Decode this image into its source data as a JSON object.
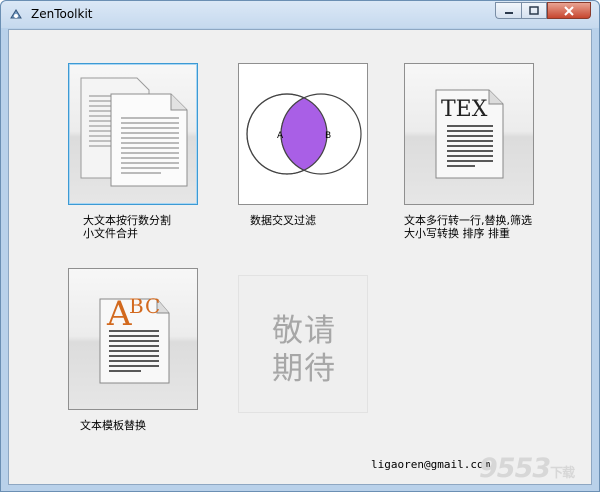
{
  "window": {
    "title": "ZenToolkit",
    "controls": {
      "minimize_icon": "minimize-icon",
      "maximize_icon": "maximize-icon",
      "close_icon": "close-icon"
    }
  },
  "tools": [
    {
      "caption": "大文本按行数分割\n小文件合并",
      "icon": "documents-icon"
    },
    {
      "caption": "数据交叉过滤",
      "icon": "venn-diagram-icon",
      "venn": {
        "left": "A",
        "right": "B",
        "overlap_color": "#a95fe6"
      }
    },
    {
      "caption": "文本多行转一行,替换,筛选\n大小写转换 排序 排重",
      "icon": "tex-document-icon",
      "icon_text": "TEX"
    },
    {
      "caption": "文本模板替换",
      "icon": "abc-template-icon",
      "icon_text": {
        "a": "A",
        "b": "B",
        "c": "C"
      },
      "accent": "#d2691e"
    }
  ],
  "coming_soon": {
    "label": "敬请\n期待"
  },
  "footer": {
    "email": "ligaoren@gmail.com",
    "watermark": "9553",
    "watermark_suffix": "下载"
  }
}
